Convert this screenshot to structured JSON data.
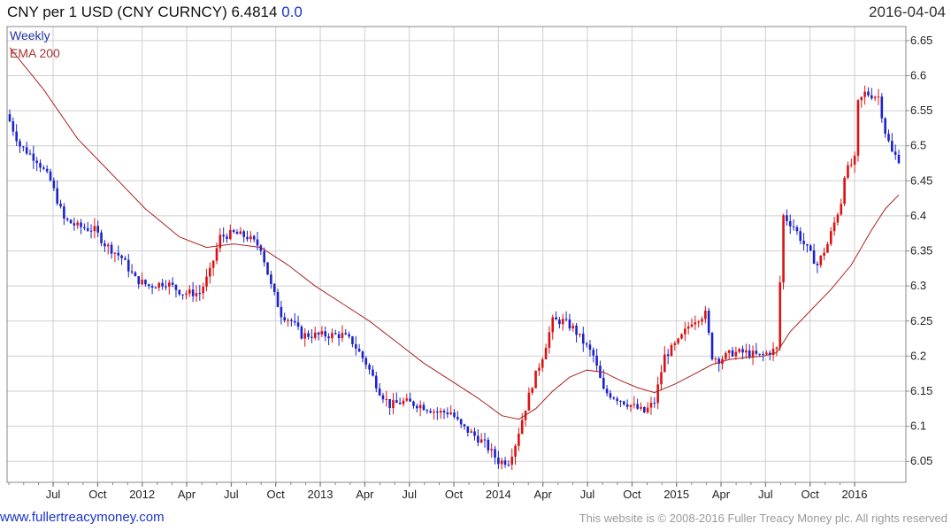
{
  "header": {
    "title": "CNY per 1 USD (CNY CURNCY) 6.4814",
    "change": "0.0",
    "date": "2016-04-04"
  },
  "legend": {
    "period": "Weekly",
    "ema_label": "EMA 200"
  },
  "footer": {
    "site": "www.fullertreacymoney.com",
    "copyright": "This website is © 2008-2016 Fuller Treacy Money plc. All rights reserved"
  },
  "colors": {
    "up": "#1a22cc",
    "down": "#dd1111",
    "ema": "#aa2222",
    "grid": "#cfcfcf"
  },
  "chart_data": {
    "type": "candlestick",
    "y_axis_side": "right",
    "ylim": [
      6.02,
      6.67
    ],
    "yticks": [
      6.05,
      6.1,
      6.15,
      6.2,
      6.25,
      6.3,
      6.35,
      6.4,
      6.45,
      6.5,
      6.55,
      6.6,
      6.65
    ],
    "xticks": [
      "Jul",
      "Oct",
      "2012",
      "Apr",
      "Jul",
      "Oct",
      "2013",
      "Apr",
      "Jul",
      "Oct",
      "2014",
      "Apr",
      "Jul",
      "Oct",
      "2015",
      "Apr",
      "Jul",
      "Oct",
      "2016"
    ],
    "grid": true,
    "weeks_total": 262,
    "close_anchors": [
      [
        0,
        6.535
      ],
      [
        3,
        6.5
      ],
      [
        8,
        6.48
      ],
      [
        12,
        6.45
      ],
      [
        16,
        6.395
      ],
      [
        20,
        6.385
      ],
      [
        25,
        6.38
      ],
      [
        28,
        6.36
      ],
      [
        33,
        6.34
      ],
      [
        37,
        6.31
      ],
      [
        41,
        6.3
      ],
      [
        46,
        6.305
      ],
      [
        51,
        6.29
      ],
      [
        56,
        6.29
      ],
      [
        59,
        6.32
      ],
      [
        62,
        6.37
      ],
      [
        66,
        6.375
      ],
      [
        70,
        6.37
      ],
      [
        74,
        6.355
      ],
      [
        77,
        6.3
      ],
      [
        80,
        6.26
      ],
      [
        83,
        6.25
      ],
      [
        86,
        6.23
      ],
      [
        90,
        6.23
      ],
      [
        94,
        6.23
      ],
      [
        98,
        6.23
      ],
      [
        101,
        6.22
      ],
      [
        105,
        6.19
      ],
      [
        109,
        6.15
      ],
      [
        112,
        6.13
      ],
      [
        116,
        6.135
      ],
      [
        121,
        6.13
      ],
      [
        126,
        6.12
      ],
      [
        130,
        6.12
      ],
      [
        133,
        6.1
      ],
      [
        136,
        6.09
      ],
      [
        140,
        6.075
      ],
      [
        144,
        6.05
      ],
      [
        147,
        6.05
      ],
      [
        149,
        6.075
      ],
      [
        151,
        6.11
      ],
      [
        154,
        6.16
      ],
      [
        157,
        6.2
      ],
      [
        160,
        6.25
      ],
      [
        163,
        6.25
      ],
      [
        166,
        6.24
      ],
      [
        169,
        6.22
      ],
      [
        172,
        6.2
      ],
      [
        175,
        6.15
      ],
      [
        179,
        6.14
      ],
      [
        183,
        6.13
      ],
      [
        187,
        6.12
      ],
      [
        190,
        6.135
      ],
      [
        193,
        6.2
      ],
      [
        197,
        6.22
      ],
      [
        201,
        6.25
      ],
      [
        205,
        6.26
      ],
      [
        207,
        6.2
      ],
      [
        209,
        6.195
      ],
      [
        213,
        6.205
      ],
      [
        217,
        6.205
      ],
      [
        221,
        6.2
      ],
      [
        226,
        6.21
      ],
      [
        228,
        6.4
      ],
      [
        231,
        6.385
      ],
      [
        234,
        6.36
      ],
      [
        238,
        6.33
      ],
      [
        241,
        6.36
      ],
      [
        245,
        6.42
      ],
      [
        246,
        6.46
      ],
      [
        249,
        6.48
      ],
      [
        250,
        6.56
      ],
      [
        252,
        6.575
      ],
      [
        256,
        6.57
      ],
      [
        258,
        6.52
      ],
      [
        260,
        6.49
      ],
      [
        262,
        6.481
      ]
    ],
    "ema_200": [
      [
        0,
        6.64
      ],
      [
        10,
        6.58
      ],
      [
        20,
        6.51
      ],
      [
        30,
        6.46
      ],
      [
        40,
        6.41
      ],
      [
        50,
        6.37
      ],
      [
        58,
        6.355
      ],
      [
        66,
        6.36
      ],
      [
        74,
        6.355
      ],
      [
        82,
        6.33
      ],
      [
        90,
        6.3
      ],
      [
        98,
        6.275
      ],
      [
        106,
        6.25
      ],
      [
        114,
        6.22
      ],
      [
        122,
        6.19
      ],
      [
        130,
        6.165
      ],
      [
        138,
        6.14
      ],
      [
        145,
        6.115
      ],
      [
        150,
        6.11
      ],
      [
        155,
        6.125
      ],
      [
        160,
        6.15
      ],
      [
        165,
        6.17
      ],
      [
        170,
        6.18
      ],
      [
        175,
        6.177
      ],
      [
        180,
        6.165
      ],
      [
        185,
        6.155
      ],
      [
        190,
        6.148
      ],
      [
        196,
        6.16
      ],
      [
        202,
        6.175
      ],
      [
        207,
        6.188
      ],
      [
        212,
        6.195
      ],
      [
        217,
        6.198
      ],
      [
        222,
        6.2
      ],
      [
        226,
        6.205
      ],
      [
        230,
        6.235
      ],
      [
        236,
        6.265
      ],
      [
        242,
        6.295
      ],
      [
        248,
        6.33
      ],
      [
        254,
        6.38
      ],
      [
        258,
        6.41
      ],
      [
        262,
        6.43
      ]
    ]
  }
}
